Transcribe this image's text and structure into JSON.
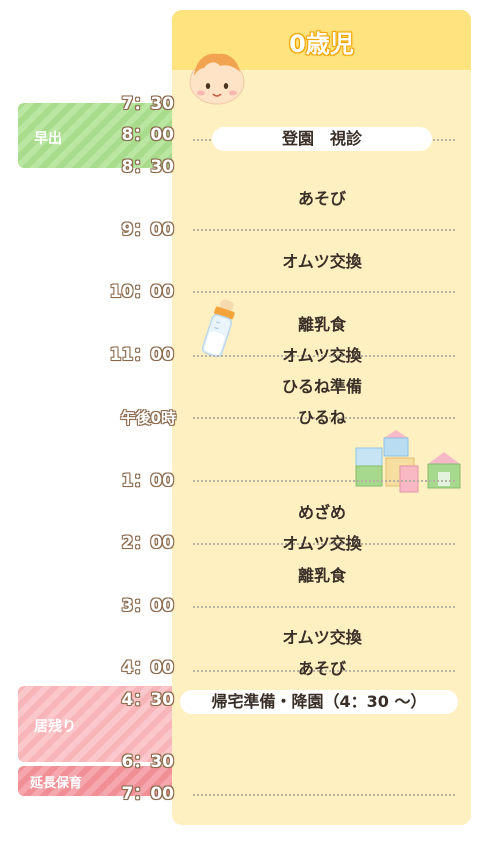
{
  "title": "0歳児",
  "bands": {
    "early": "早出",
    "stay": "居残り",
    "extended": "延長保育"
  },
  "times": [
    "7：30",
    "8：00",
    "8：30",
    "9：00",
    "10：00",
    "11：00",
    "午後0時",
    "1：00",
    "2：00",
    "3：00",
    "4：00",
    "4：30",
    "6：30",
    "7：00"
  ],
  "activities": {
    "arrival": "登園　視診",
    "play1": "あそび",
    "diaper1": "オムツ交換",
    "baby_food1": "離乳食",
    "diaper2": "オムツ交換",
    "nap_prep": "ひるね準備",
    "nap": "ひるね",
    "wake": "めざめ",
    "diaper3": "オムツ交換",
    "baby_food2": "離乳食",
    "diaper4": "オムツ交換",
    "play2": "あそび",
    "departure": "帰宅準備・降園（4：30 ～）"
  },
  "colors": {
    "card": "#fff0c2",
    "header": "#ffe37f",
    "early_band": "#a8dc8c",
    "stay_band": "#f8b5b9",
    "extended_band": "#f18f96"
  },
  "icons": [
    "baby-face-icon",
    "baby-bottle-icon",
    "toy-blocks-icon"
  ]
}
